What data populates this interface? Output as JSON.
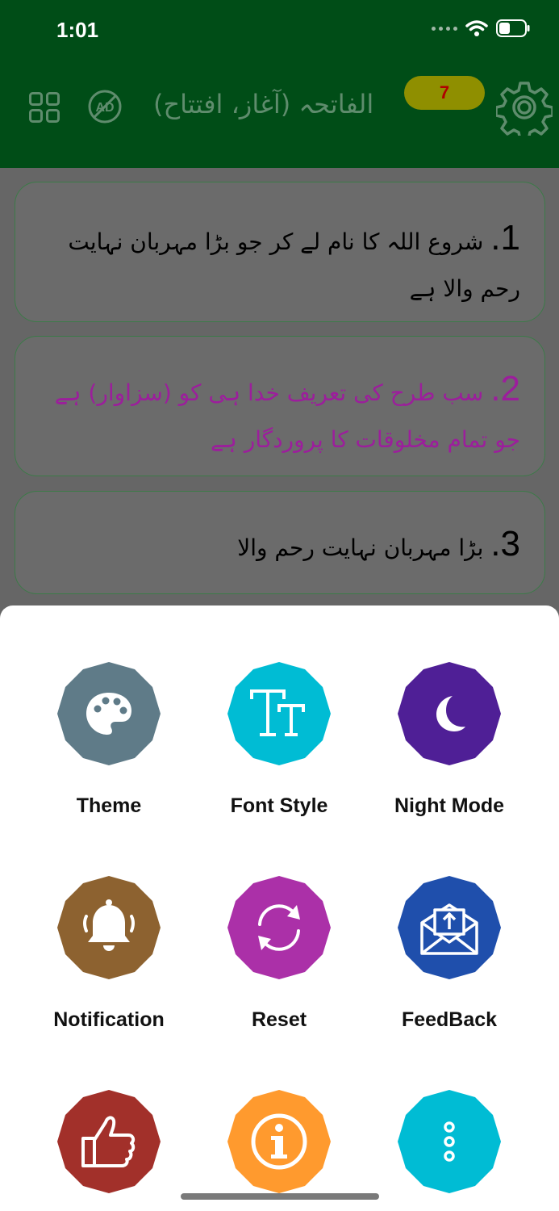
{
  "status_bar": {
    "time": "1:01"
  },
  "header": {
    "title": "الفاتحہ (آغاز، افتتاح)",
    "badge_count": "7",
    "icons": [
      "grid-icon",
      "no-ads-icon",
      "settings-gear-icon"
    ],
    "colors": {
      "background": "#004d17",
      "badge": "#8f8f00",
      "badge_text": "#b00000"
    }
  },
  "verses": [
    {
      "number": "1.",
      "text": "شروع اللہ کا نام لے کر جو بڑا مہربان نہایت رحم والا ہے"
    },
    {
      "number": "2.",
      "text": "سب طرح کی تعریف خدا ہی کو (سزاوار) ہے جو تمام مخلوقات کا پروردگار ہے"
    },
    {
      "number": "3.",
      "text": "بڑا مہربان نہایت رحم والا"
    }
  ],
  "menu": {
    "items": [
      {
        "label": "Theme",
        "icon": "palette-icon",
        "color": "#5f7b88"
      },
      {
        "label": "Font Style",
        "icon": "font-size-icon",
        "color": "#00bcd4"
      },
      {
        "label": "Night Mode",
        "icon": "moon-icon",
        "color": "#4f1f96"
      },
      {
        "label": "Notification",
        "icon": "bell-icon",
        "color": "#8d6230"
      },
      {
        "label": "Reset",
        "icon": "refresh-icon",
        "color": "#ab30a8"
      },
      {
        "label": "FeedBack",
        "icon": "mail-icon",
        "color": "#1f4fac"
      },
      {
        "label": "",
        "icon": "thumbs-up-icon",
        "color": "#a2302a"
      },
      {
        "label": "",
        "icon": "info-icon",
        "color": "#ff9a2e"
      },
      {
        "label": "",
        "icon": "more-vertical-icon",
        "color": "#00bcd4"
      }
    ]
  }
}
